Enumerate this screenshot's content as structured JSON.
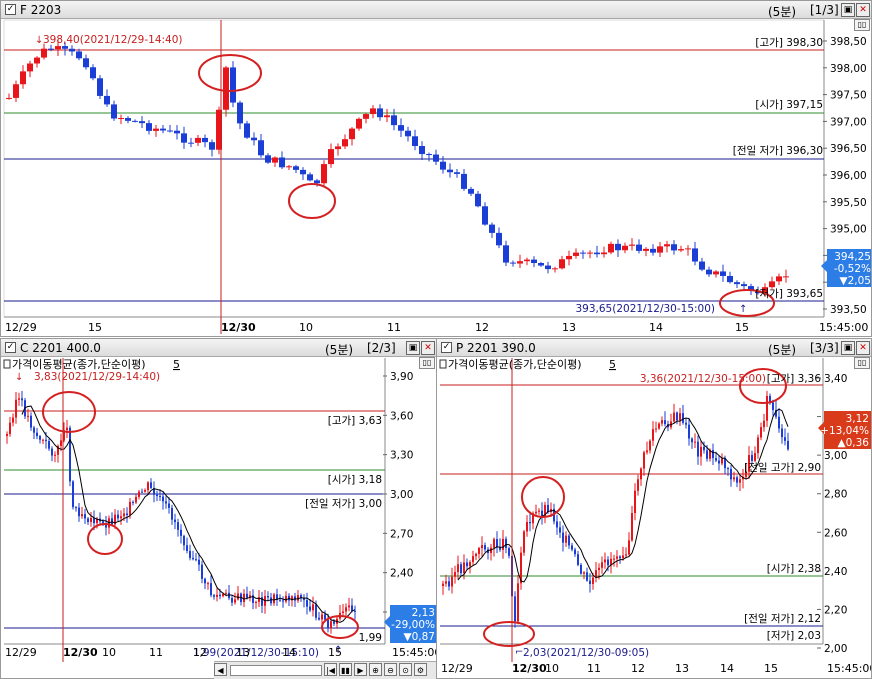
{
  "panels": {
    "f": {
      "title": "F 2203",
      "period": "(5분)",
      "page": "[1/3]",
      "yticks": [
        "398,50",
        "398,00",
        "397,50",
        "397,00",
        "396,50",
        "396,00",
        "395,50",
        "395,00",
        "394,50",
        "394,00",
        "393,50"
      ],
      "xticks": [
        "12/29",
        "15",
        "12/30",
        "10",
        "11",
        "12",
        "13",
        "14",
        "15",
        "15:45:00"
      ],
      "annotations": {
        "high_mark": "398,40(2021/12/29-14:40)",
        "high": "[고가] 398,30",
        "open": "[시가] 397,15",
        "prev_low": "[전일 저가] 396,30",
        "low": "[저가] 393,65",
        "low_mark": "393,65(2021/12/30-15:00)"
      },
      "badge": {
        "price": "394,25",
        "pct": "-0,52%",
        "chg": "▼2,05"
      }
    },
    "c": {
      "title": "C 2201  400.0",
      "period": "(5분)",
      "page": "[2/3]",
      "ma_label": "가격이동평균(종가,단순이평)",
      "ma_period": "5",
      "yticks": [
        "3,90",
        "3,60",
        "3,30",
        "3,00",
        "2,70",
        "2,40",
        "2,10"
      ],
      "xticks": [
        "12/29",
        "12/30",
        "10",
        "11",
        "12",
        "13",
        "14",
        "15",
        "15:45:00"
      ],
      "annotations": {
        "high_mark": "3,83(2021/12/29-14:40)",
        "high": "[고가] 3,63",
        "open": "[시가] 3,18",
        "prev_low": "[전일 저가] 3,00",
        "low": "1,99",
        "low_mark": "1,99(2021/12/30-15:10)"
      },
      "badge": {
        "price": "2,13",
        "pct": "-29,00%",
        "chg": "▼0,87"
      }
    },
    "p": {
      "title": "P 2201  390.0",
      "period": "(5분)",
      "page": "[3/3]",
      "ma_label": "가격이동평균(종가,단순이평)",
      "ma_period": "5",
      "yticks": [
        "3,40",
        "3,20",
        "3,00",
        "2,80",
        "2,60",
        "2,40",
        "2,20",
        "2,00"
      ],
      "xticks": [
        "12/29",
        "12/30",
        "10",
        "11",
        "12",
        "13",
        "14",
        "15",
        "15:45:00"
      ],
      "annotations": {
        "high_mark": "3,36(2021/12/30-15:00)",
        "high": "[고가] 3,36",
        "prev_high": "[전일 고가] 2,90",
        "open": "[시가] 2,38",
        "prev_low": "[전일 저가] 2,12",
        "low": "[저가] 2,03",
        "low_mark": "2,03(2021/12/30-09:05)"
      },
      "badge": {
        "price": "3,12",
        "pct": "+13,04%",
        "chg": "▲0,36"
      }
    }
  },
  "colors": {
    "up": "#e8161a",
    "down": "#1b3fd6",
    "hline_red": "#c81e1e",
    "hline_blue": "#1a1a8c",
    "hline_green": "#2e8b2e"
  }
}
